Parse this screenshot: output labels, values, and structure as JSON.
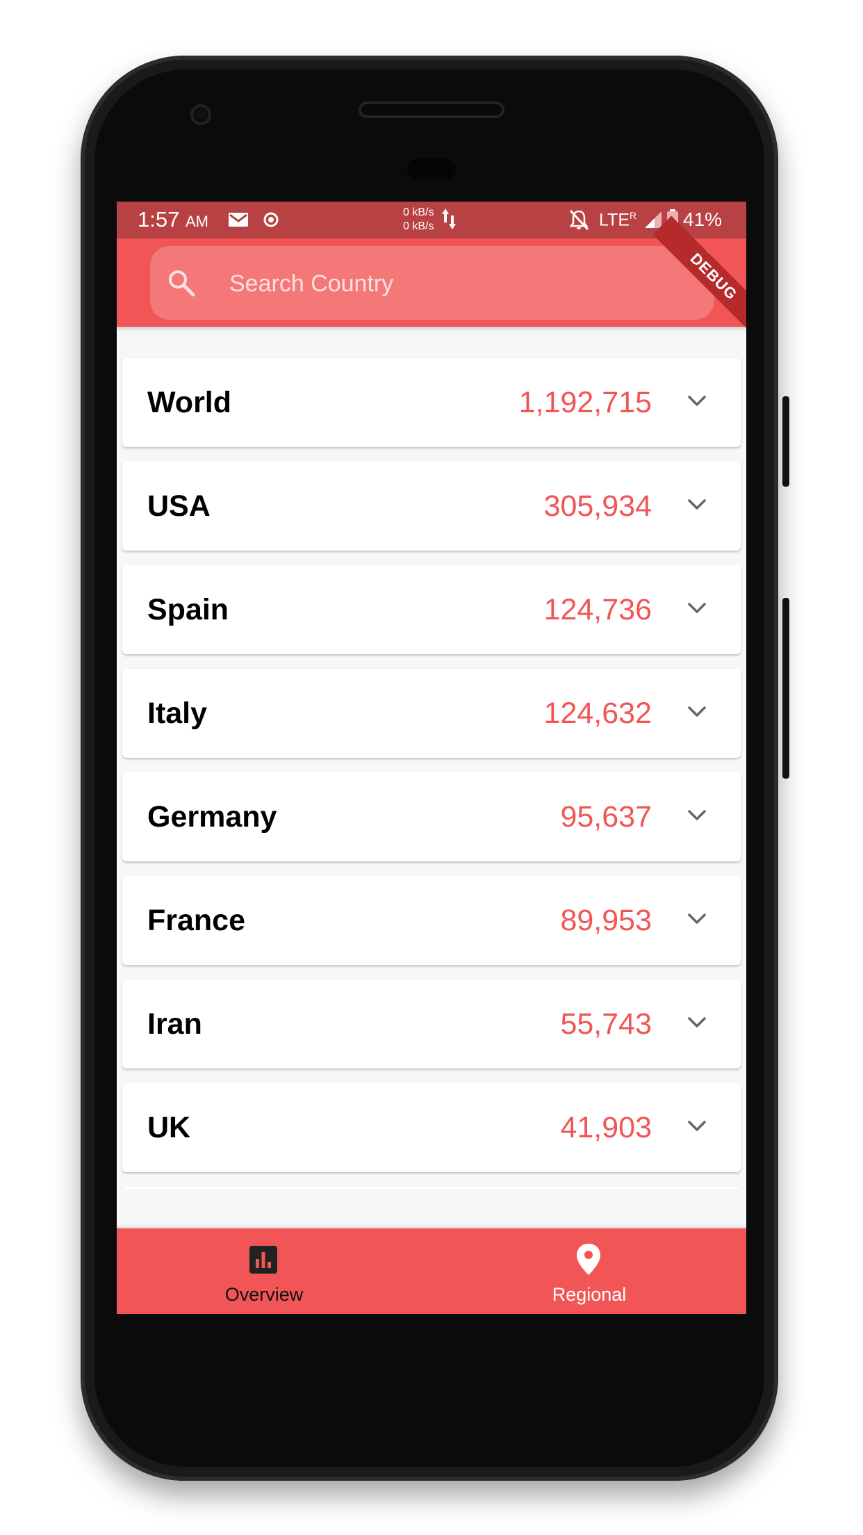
{
  "status_bar": {
    "time": "1:57",
    "ampm": "AM",
    "speed_up": "0 kB/s",
    "speed_down": "0 kB/s",
    "network": "LTE",
    "roaming": "R",
    "battery": "41%"
  },
  "debug_banner": "DEBUG",
  "search": {
    "placeholder": "Search Country",
    "value": ""
  },
  "countries": [
    {
      "name": "World",
      "cases": "1,192,715"
    },
    {
      "name": "USA",
      "cases": "305,934"
    },
    {
      "name": "Spain",
      "cases": "124,736"
    },
    {
      "name": "Italy",
      "cases": "124,632"
    },
    {
      "name": "Germany",
      "cases": "95,637"
    },
    {
      "name": "France",
      "cases": "89,953"
    },
    {
      "name": "Iran",
      "cases": "55,743"
    },
    {
      "name": "UK",
      "cases": "41,903"
    }
  ],
  "colors": {
    "accent": "#f25555",
    "status_bar": "#b84143",
    "count_text": "#f25555"
  },
  "bottom_nav": {
    "items": [
      {
        "label": "Overview",
        "icon": "bar-chart-icon",
        "selected": true
      },
      {
        "label": "Regional",
        "icon": "location-pin-icon",
        "selected": false
      }
    ]
  }
}
